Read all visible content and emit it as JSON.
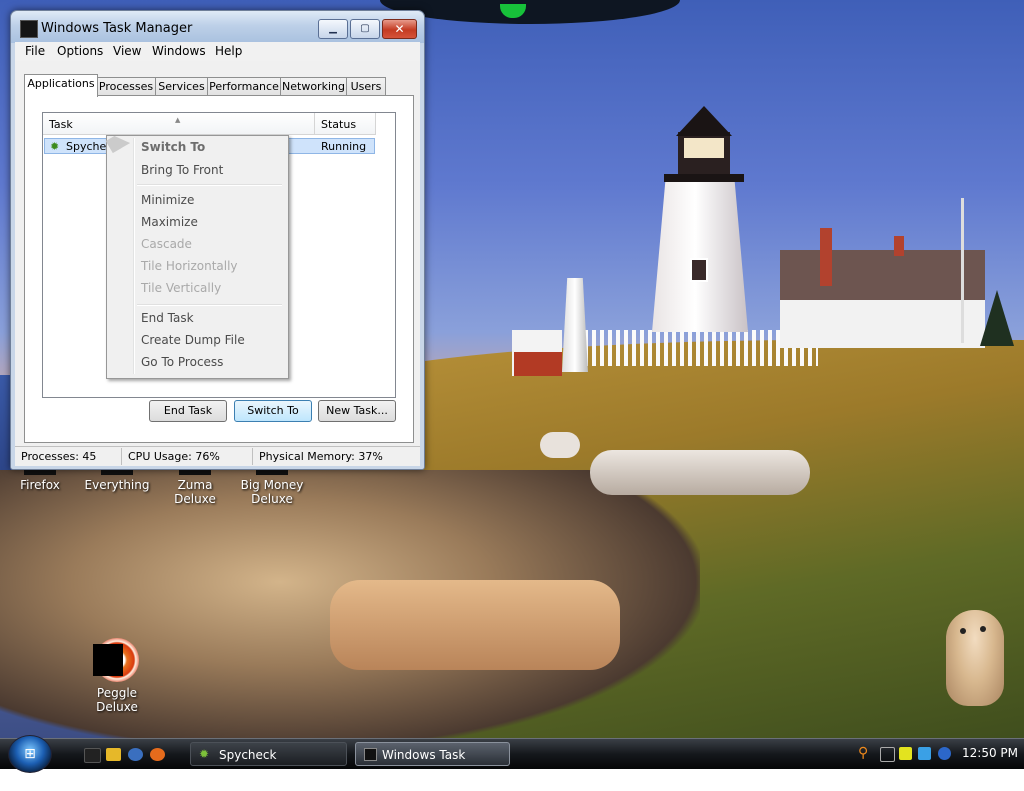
{
  "window": {
    "title": "Windows Task Manager",
    "minimize_label": "▁",
    "maximize_label": "▢",
    "close_label": "✕"
  },
  "menu": [
    "File",
    "Options",
    "View",
    "Windows",
    "Help"
  ],
  "tabs": [
    "Applications",
    "Processes",
    "Services",
    "Performance",
    "Networking",
    "Users"
  ],
  "active_tab": "Applications",
  "table": {
    "headers": [
      "Task",
      "Status"
    ],
    "rows": [
      {
        "task": "Spycheck",
        "status": "Running"
      }
    ]
  },
  "buttons": {
    "end_task": "End Task",
    "switch_to": "Switch To",
    "new_task": "New Task..."
  },
  "status_bar": {
    "processes": "Processes: 45",
    "cpu": "CPU Usage: 76%",
    "memory": "Physical Memory: 37%"
  },
  "context_menu": {
    "items": [
      {
        "label": "Switch To",
        "state": "default"
      },
      {
        "label": "Bring To Front",
        "state": "enabled"
      },
      {
        "label": "Minimize",
        "state": "enabled"
      },
      {
        "label": "Maximize",
        "state": "enabled"
      },
      {
        "label": "Cascade",
        "state": "disabled"
      },
      {
        "label": "Tile Horizontally",
        "state": "disabled"
      },
      {
        "label": "Tile Vertically",
        "state": "disabled"
      },
      {
        "label": "End Task",
        "state": "enabled"
      },
      {
        "label": "Create Dump File",
        "state": "enabled"
      },
      {
        "label": "Go To Process",
        "state": "enabled"
      }
    ]
  },
  "desktop_icons": {
    "firefox": "Firefox",
    "everything": "Everything",
    "zuma": "Zuma Deluxe",
    "bigmoney_line1": "Big Money",
    "bigmoney_line2": "Deluxe",
    "peggle": "Peggle Deluxe"
  },
  "taskbar": {
    "items": [
      {
        "label": "Spycheck",
        "icon": "spycheck-bug-icon"
      },
      {
        "label": "Windows Task Mana...",
        "icon": "task-manager-icon"
      }
    ],
    "clock": "12:50 PM"
  },
  "colors": {
    "selection": "#cfe3fb",
    "close_button": "#c43b22",
    "taskbar": "#15181c"
  }
}
